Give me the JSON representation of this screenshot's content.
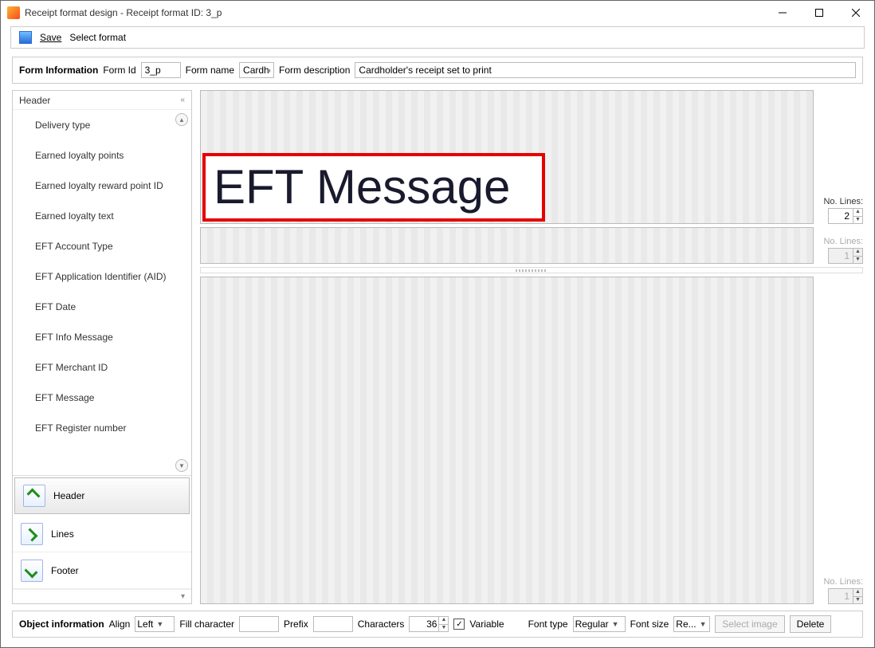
{
  "window": {
    "title": "Receipt format design - Receipt format ID: 3_p"
  },
  "toolbar": {
    "save": "Save",
    "select_format": "Select format"
  },
  "form_info": {
    "section": "Form Information",
    "form_id_label": "Form Id",
    "form_id": "3_p",
    "form_name_label": "Form name",
    "form_name": "Cardhold",
    "form_desc_label": "Form description",
    "form_desc": "Cardholder's receipt set to print"
  },
  "sidebar": {
    "header": "Header",
    "items": [
      "Delivery type",
      "Earned loyalty points",
      "Earned loyalty reward point ID",
      "Earned loyalty text",
      "EFT Account Type",
      "EFT Application Identifier (AID)",
      "EFT Date",
      "EFT Info Message",
      "EFT Merchant ID",
      "EFT Message",
      "EFT Register number"
    ],
    "sections": {
      "header": "Header",
      "lines": "Lines",
      "footer": "Footer"
    }
  },
  "canvas": {
    "placed_label": "EFT Message",
    "no_lines_label": "No. Lines:",
    "lines1": "2",
    "lines2": "1",
    "lines3": "1"
  },
  "object_info": {
    "section": "Object information",
    "align_label": "Align",
    "align_value": "Left",
    "fill_label": "Fill character",
    "fill_value": "",
    "prefix_label": "Prefix",
    "prefix_value": "",
    "chars_label": "Characters",
    "chars_value": "36",
    "variable_label": "Variable",
    "variable_checked": true,
    "font_type_label": "Font type",
    "font_type_value": "Regular",
    "font_size_label": "Font size",
    "font_size_value": "Re...",
    "select_image": "Select image",
    "delete": "Delete"
  }
}
